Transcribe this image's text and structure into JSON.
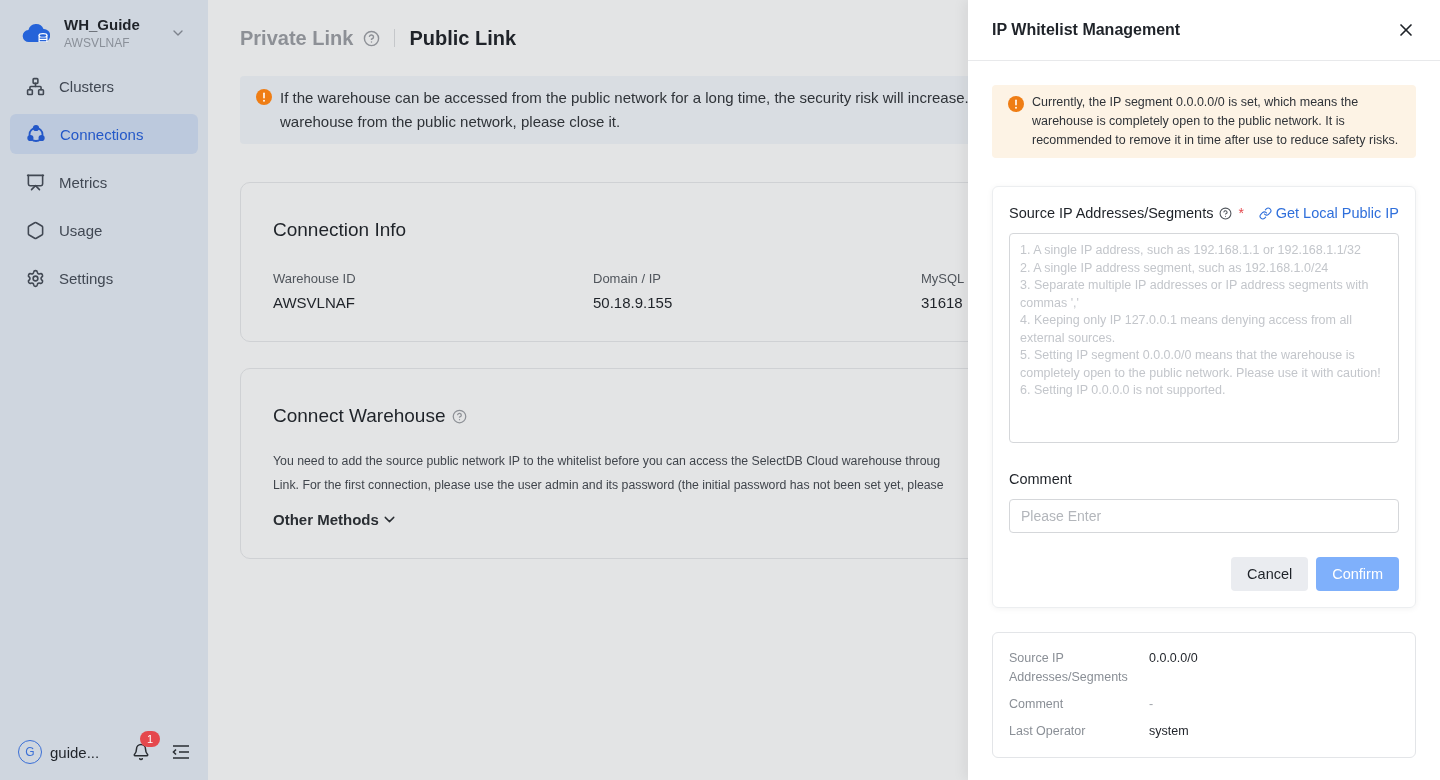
{
  "sidebar": {
    "workspace": {
      "name": "WH_Guide",
      "id": "AWSVLNAF"
    },
    "items": [
      {
        "label": "Clusters",
        "selected": false
      },
      {
        "label": "Connections",
        "selected": true
      },
      {
        "label": "Metrics",
        "selected": false
      },
      {
        "label": "Usage",
        "selected": false
      },
      {
        "label": "Settings",
        "selected": false
      }
    ],
    "user": {
      "avatar": "G",
      "name": "guide..."
    },
    "notifications": {
      "count": "1"
    }
  },
  "tabs": [
    {
      "label": "Private Link",
      "selected": false
    },
    {
      "label": "Public Link",
      "selected": true
    }
  ],
  "alert": {
    "lines": [
      "If the warehouse can be accessed from the public network for a long time, the security risk will increase.",
      "warehouse from the public network, please close it."
    ]
  },
  "connection_info": {
    "title": "Connection Info",
    "fields": [
      {
        "label": "Warehouse ID",
        "value": "AWSVLNAF"
      },
      {
        "label": "Domain / IP",
        "value": "50.18.9.155"
      },
      {
        "label": "MySQL",
        "value": "31618"
      }
    ]
  },
  "connect_warehouse": {
    "title": "Connect Warehouse",
    "lines": [
      "You need to add the source public network IP to the whitelist before you can access the SelectDB Cloud warehouse throug",
      "Link. For the first connection, please use the user admin and its password (the initial password has not been set yet, please"
    ],
    "more": "Other Methods"
  },
  "drawer": {
    "title": "IP Whitelist Management",
    "warning": "Currently, the IP segment 0.0.0.0/0 is set, which means the warehouse is completely open to the public network. It is recommended to remove it in time after use to reduce safety risks.",
    "form": {
      "source_label": "Source IP Addresses/Segments",
      "required_marker": "*",
      "get_ip": "Get Local Public IP",
      "placeholder_lines": [
        "1. A single IP address, such as 192.168.1.1 or 192.168.1.1/32",
        "2. A single IP address segment, such as 192.168.1.0/24",
        "3. Separate multiple IP addresses or IP address segments with commas ','",
        "4. Keeping only IP 127.0.0.1 means denying access from all external sources.",
        "5. Setting IP segment 0.0.0.0/0 means that the warehouse is completely open to the public network. Please use it with caution!",
        "6. Setting IP 0.0.0.0 is not supported."
      ],
      "comment_label": "Comment",
      "comment_placeholder": "Please Enter",
      "buttons": [
        {
          "label": "Cancel",
          "kind": "default",
          "disabled": false
        },
        {
          "label": "Confirm",
          "kind": "primary",
          "disabled": true
        }
      ]
    },
    "details": [
      {
        "label": "Source IP Addresses/Segments",
        "value": "0.0.0.0/0"
      },
      {
        "label": "Comment",
        "value": "-"
      },
      {
        "label": "Last Operator",
        "value": "system"
      }
    ]
  }
}
